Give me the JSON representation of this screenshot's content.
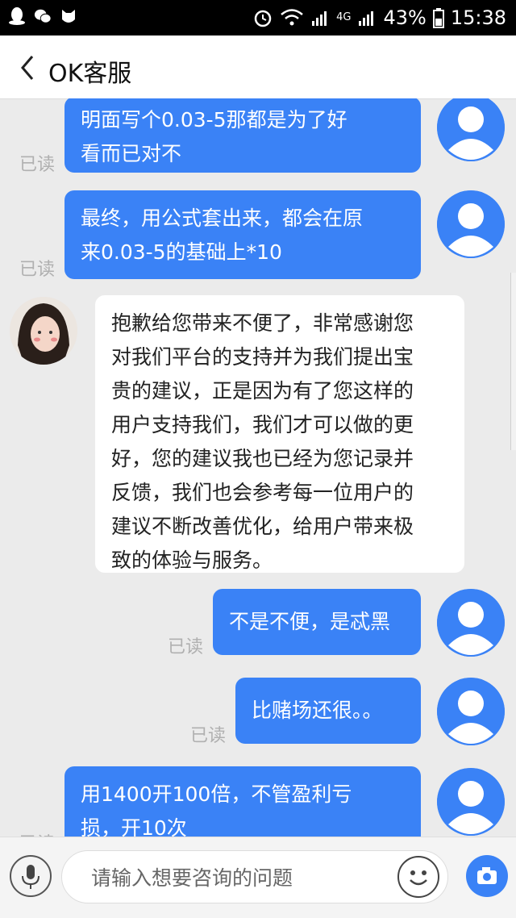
{
  "status_bar": {
    "battery": "43%",
    "time": "15:38",
    "signal_label": "4G"
  },
  "header": {
    "title": "OK客服"
  },
  "messages": [
    {
      "side": "out",
      "lines": [
        "明面写个0.03-5那都是为了好",
        "看而已对不"
      ],
      "status": "已读"
    },
    {
      "side": "out",
      "lines": [
        "最终，用公式套出来，都会在原",
        "来0.03-5的基础上*10"
      ],
      "status": "已读"
    },
    {
      "side": "in",
      "lines": [
        "抱歉给您带来不便了，非常感谢您",
        "对我们平台的支持并为我们提出宝",
        "贵的建议，正是因为有了您这样的",
        "用户支持我们，我们才可以做的更",
        "好，您的建议我也已经为您记录并",
        "反馈，我们也会参考每一位用户的",
        "建议不断改善优化，给用户带来极",
        "致的体验与服务。"
      ]
    },
    {
      "side": "out",
      "lines": [
        "不是不便，是忒黑"
      ],
      "status": "已读"
    },
    {
      "side": "out",
      "lines": [
        "比赌场还很。。"
      ],
      "status": "已读"
    },
    {
      "side": "out",
      "lines": [
        "用1400开100倍，不管盈利亏",
        "损，开10次"
      ],
      "status": "已读"
    }
  ],
  "input": {
    "placeholder": "请输入想要咨询的问题"
  },
  "colors": {
    "accent": "#3a82f6",
    "background": "#ebebeb"
  }
}
